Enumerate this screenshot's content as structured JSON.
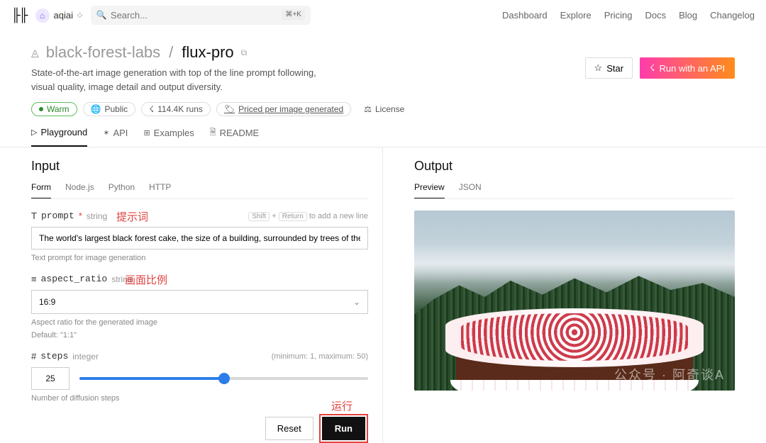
{
  "topbar": {
    "logo_text": "╟╟",
    "username": "aqiai",
    "search_placeholder": "Search...",
    "shortcut": "⌘+K",
    "nav": [
      "Dashboard",
      "Explore",
      "Pricing",
      "Docs",
      "Blog",
      "Changelog"
    ]
  },
  "header": {
    "owner": "black-forest-labs",
    "model": "flux-pro",
    "subtitle": "State-of-the-art image generation with top of the line prompt following, visual quality, image detail and output diversity.",
    "badges": {
      "warm": "Warm",
      "public": "Public",
      "runs": "114.4K runs",
      "pricing": "Priced per image generated",
      "license": "License"
    },
    "star": "Star",
    "run_api": "Run with an API"
  },
  "subtabs": [
    "Playground",
    "API",
    "Examples",
    "README"
  ],
  "input": {
    "heading": "Input",
    "code_tabs": [
      "Form",
      "Node.js",
      "Python",
      "HTTP"
    ],
    "prompt": {
      "icon": "T",
      "name": "prompt",
      "type": "string",
      "shift": "Shift",
      "ret": "Return",
      "hint_tail": "to add a new line",
      "value": "The world's largest black forest cake, the size of a building, surrounded by trees of the black forest",
      "help": "Text prompt for image generation"
    },
    "aspect": {
      "icon": "≡",
      "name": "aspect_ratio",
      "type": "string",
      "value": "16:9",
      "help": "Aspect ratio for the generated image",
      "default": "Default: \"1:1\""
    },
    "steps": {
      "icon": "#",
      "name": "steps",
      "type": "integer",
      "range_hint": "(minimum: 1, maximum: 50)",
      "value": "25",
      "help": "Number of diffusion steps"
    },
    "reset": "Reset",
    "run": "Run"
  },
  "output": {
    "heading": "Output",
    "tabs": [
      "Preview",
      "JSON"
    ],
    "watermark": "公众号 · 阿奇谈A"
  },
  "annotations": {
    "prompt": "提示词",
    "aspect": "画面比例",
    "run": "运行"
  }
}
